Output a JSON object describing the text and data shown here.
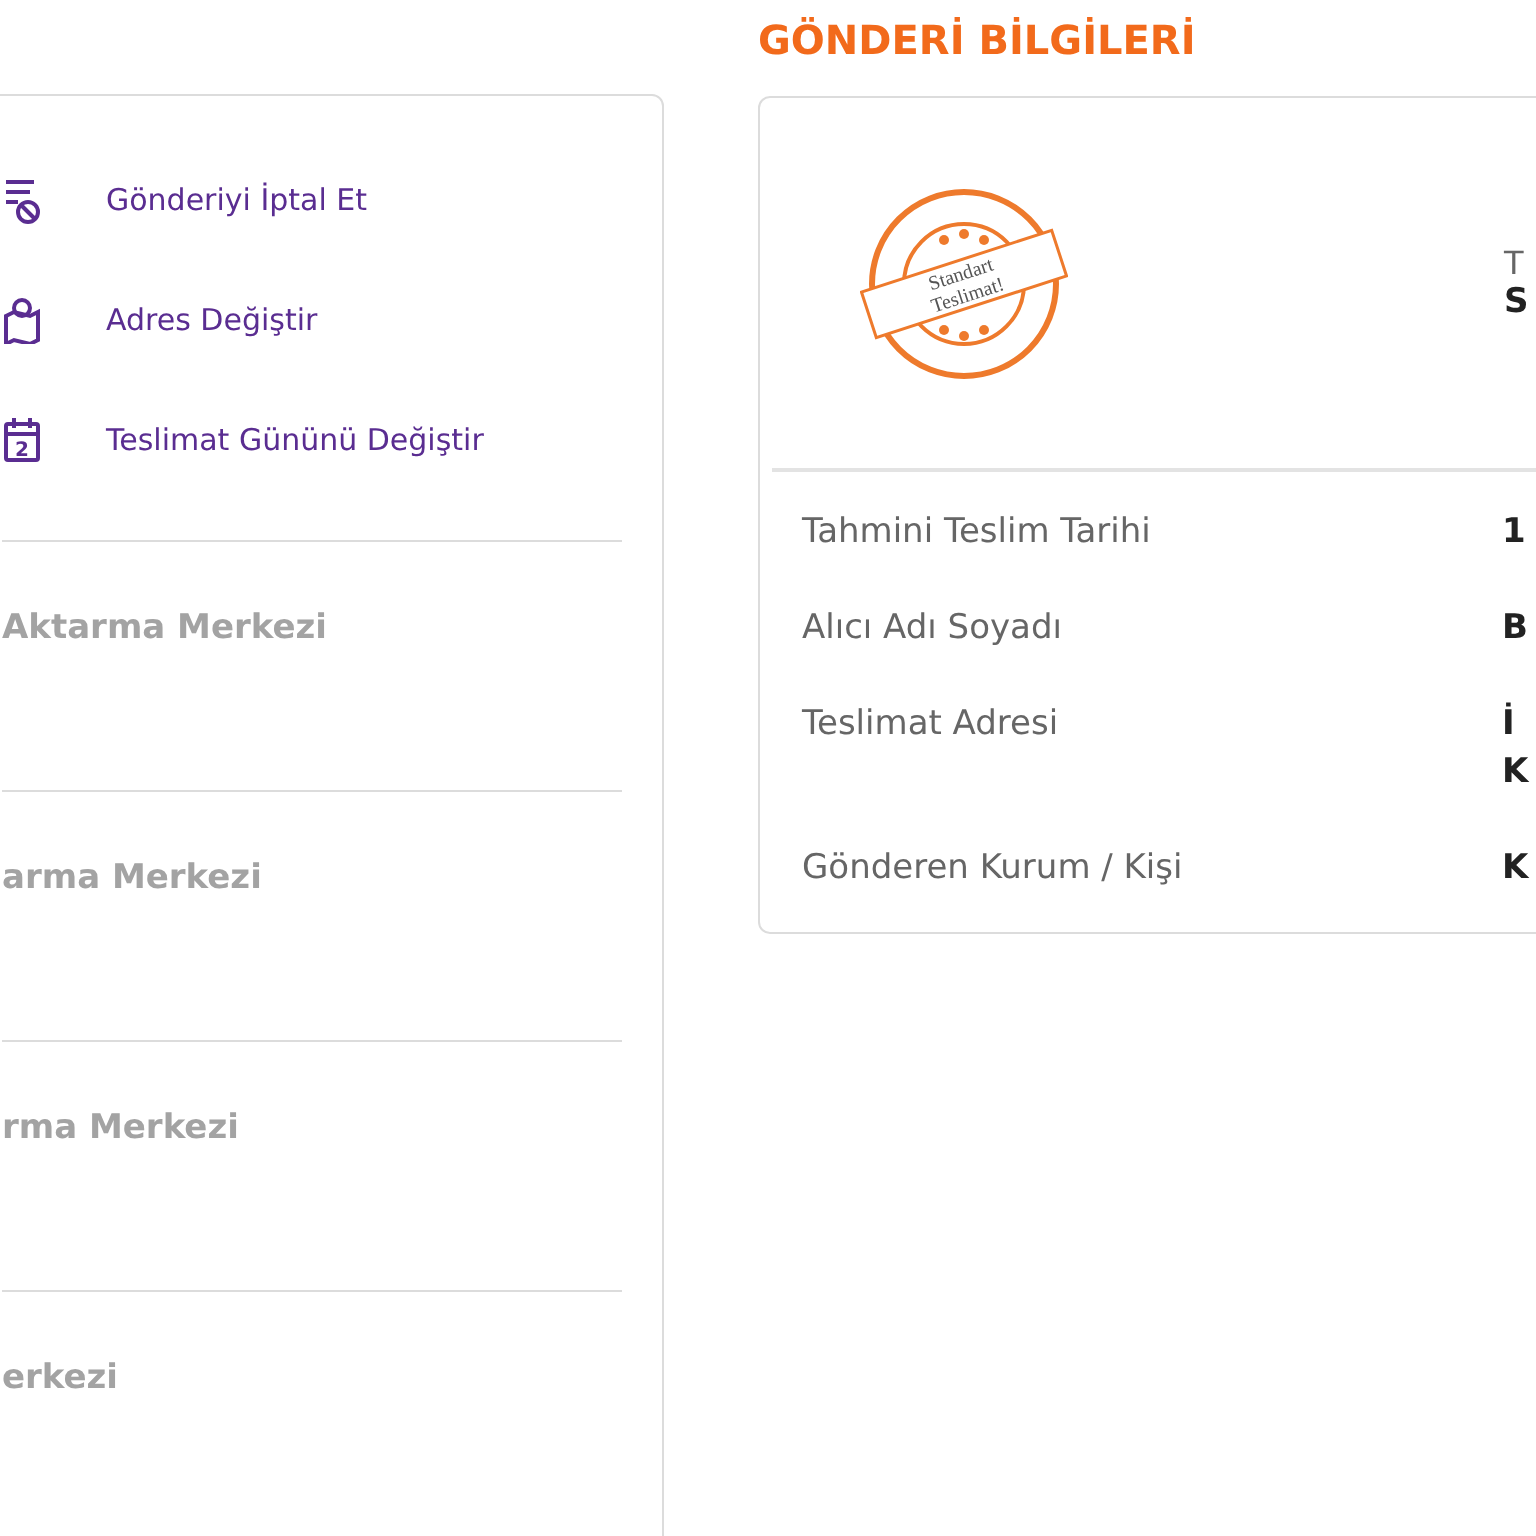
{
  "actions": [
    {
      "kind": "cancel",
      "label": "Gönderiyi İptal Et"
    },
    {
      "kind": "address",
      "label": "Adres Değiştir"
    },
    {
      "kind": "calendar",
      "label": "Teslimat Gününü Değiştir",
      "day": "2"
    }
  ],
  "timeline": [
    "Aktarma Merkezi",
    "arma Merkezi",
    "rma Merkezi",
    "erkezi"
  ],
  "section_title": "GÖNDERİ BİLGİLERİ",
  "stamp": {
    "line_1": "Standart",
    "line_2": "Teslimat!"
  },
  "delivery_type": {
    "label": "T",
    "value": "S"
  },
  "details": [
    {
      "label": "Tahmini Teslim Tarihi",
      "value": [
        "1"
      ]
    },
    {
      "label": "Alıcı Adı Soyadı",
      "value": [
        "B"
      ]
    },
    {
      "label": "Teslimat Adresi",
      "value": [
        "İ",
        "K"
      ]
    },
    {
      "label": "Gönderen Kurum / Kişi",
      "value": [
        "K"
      ]
    }
  ]
}
